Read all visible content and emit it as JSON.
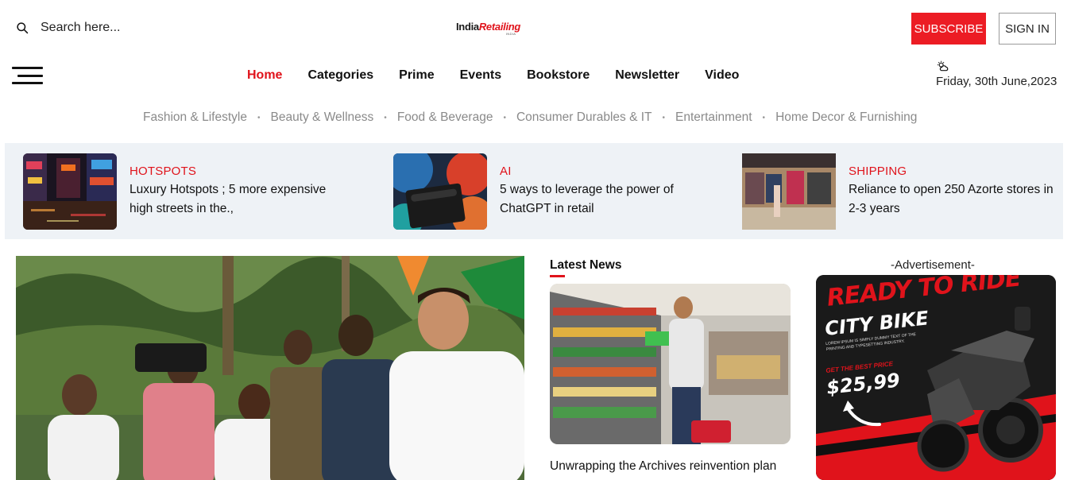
{
  "header": {
    "search_placeholder": "Search here...",
    "logo_part1": "India",
    "logo_part2": "Retailing",
    "logo_tag": "INDIA",
    "subscribe_label": "SUBSCRIBE",
    "signin_label": "SIGN IN"
  },
  "nav": {
    "items": [
      "Home",
      "Categories",
      "Prime",
      "Events",
      "Bookstore",
      "Newsletter",
      "Video"
    ],
    "active": "Home"
  },
  "weather": {
    "icon": "cloud-sun-icon",
    "date": "Friday, 30th June,2023"
  },
  "categories": [
    "Fashion & Lifestyle",
    "Beauty & Wellness",
    "Food & Beverage",
    "Consumer Durables & IT",
    "Entertainment",
    "Home Decor & Furnishing"
  ],
  "featured": [
    {
      "tag": "HOTSPOTS",
      "title": "Luxury Hotspots ; 5 more expensive high streets in the.,"
    },
    {
      "tag": "AI",
      "title": "5 ways to leverage the power of ChatGPT in retail"
    },
    {
      "tag": "SHIPPING",
      "title": "Reliance to open 250 Azorte stores in 2-3 years"
    }
  ],
  "latest": {
    "heading": "Latest News",
    "title": "Unwrapping the Archives reinvention plan"
  },
  "ad": {
    "label": "-Advertisement-",
    "headline": "READY TO RIDE",
    "subheadline": "CITY BIKE",
    "small_text": "LOREM IPSUM IS SIMPLY DUMMY TEXT OF THE PRINTING AND TYPESETTING INDUSTRY.",
    "best_price_label": "GET THE BEST PRICE",
    "price": "$25,99"
  },
  "colors": {
    "accent": "#e0131b",
    "subscribe_bg": "#ec1c24",
    "strip_bg": "#eef2f6",
    "muted_text": "#8a8a8a"
  }
}
